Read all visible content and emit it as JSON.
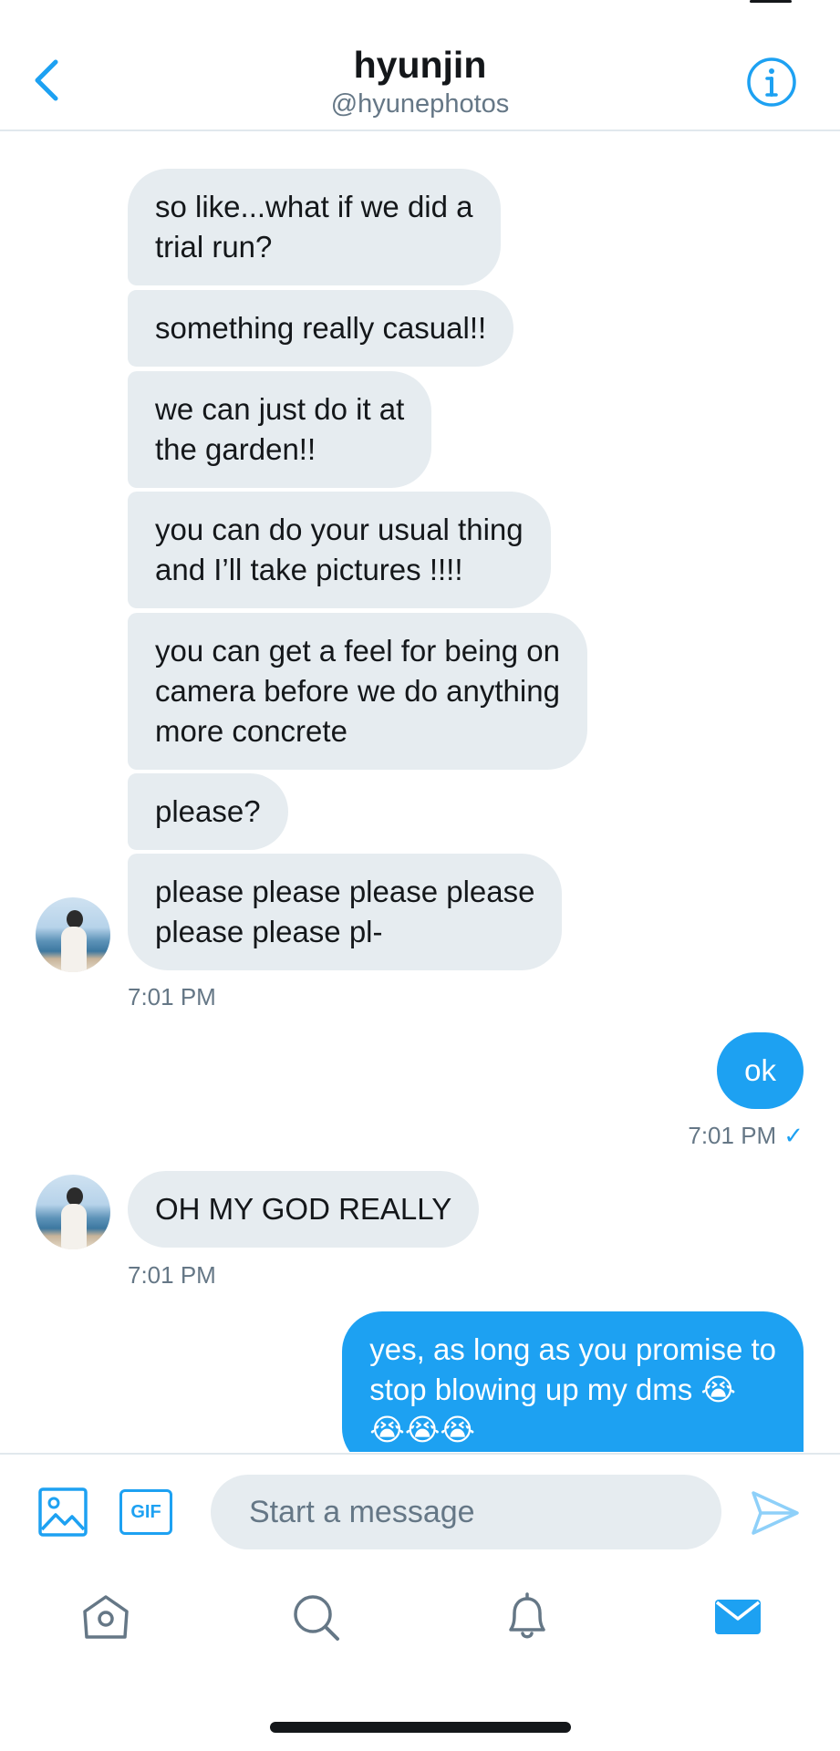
{
  "header": {
    "title": "hyunjin",
    "handle": "@hyunephotos"
  },
  "messages": [
    {
      "text": "so like...what if we did a\ntrial run?"
    },
    {
      "text": "something really casual!!"
    },
    {
      "text": "we can just do it at\nthe garden!!"
    },
    {
      "text": "you can do your usual thing\nand I’ll take pictures !!!!"
    },
    {
      "text": "you can get a feel for being on\ncamera before we do anything\nmore concrete"
    },
    {
      "text": "please?"
    },
    {
      "text": "please please please please\nplease please pl-"
    },
    {
      "text": "ok"
    },
    {
      "text": "OH MY GOD REALLY"
    },
    {
      "text": "yes, as long as you promise to\nstop blowing up my dms 😭\n😭😭😭"
    }
  ],
  "timestamps": [
    "7:01 PM",
    "7:01 PM",
    "7:01 PM"
  ],
  "read_check": "✓",
  "composer": {
    "gif_label": "GIF",
    "placeholder": "Start a message"
  },
  "icons": {
    "back": "chevron-left-icon",
    "info": "info-icon",
    "media": "image-icon",
    "send": "send-icon",
    "home": "home-icon",
    "search": "search-icon",
    "notifications": "bell-icon",
    "messages": "mail-icon"
  },
  "colors": {
    "accent": "#1da1f2",
    "incoming_bubble": "#e6ecf0",
    "secondary_text": "#657786"
  }
}
